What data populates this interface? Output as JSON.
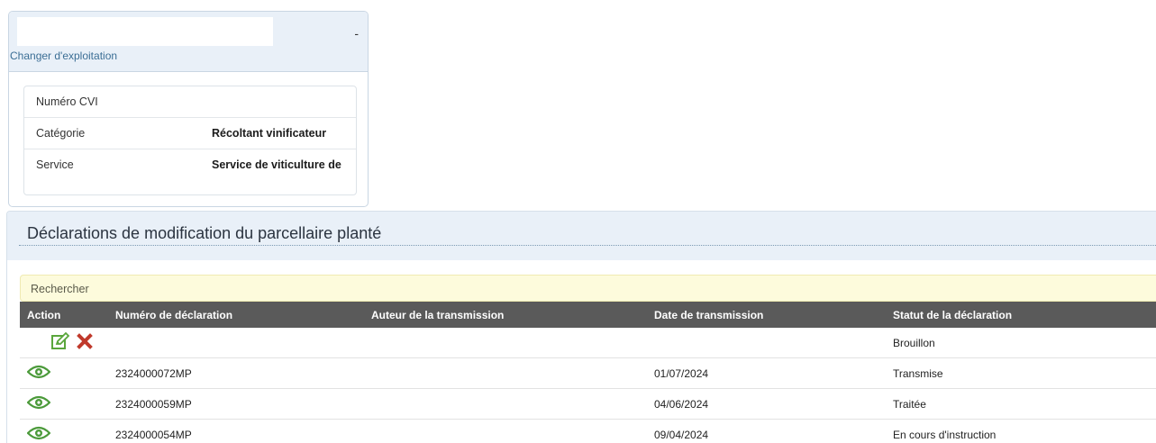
{
  "exploitation": {
    "dash": "-",
    "change_link": "Changer d'exploitation",
    "fields": [
      {
        "label": "Numéro CVI",
        "value": ""
      },
      {
        "label": "Catégorie",
        "value": "Récoltant vinificateur"
      },
      {
        "label": "Service",
        "value": "Service de viticulture de"
      }
    ]
  },
  "panel": {
    "title": "Déclarations de modification du parcellaire planté",
    "search_label": "Rechercher"
  },
  "table": {
    "headers": {
      "action": "Action",
      "numero": "Numéro de déclaration",
      "auteur": "Auteur de la transmission",
      "date": "Date de transmission",
      "statut": "Statut de la déclaration"
    },
    "rows": [
      {
        "actions": [
          "edit-icon",
          "delete-icon"
        ],
        "numero": "",
        "auteur": "",
        "date": "",
        "statut": "Brouillon"
      },
      {
        "actions": [
          "view-icon"
        ],
        "numero": "2324000072MP",
        "auteur": "",
        "date": "01/07/2024",
        "statut": "Transmise"
      },
      {
        "actions": [
          "view-icon"
        ],
        "numero": "2324000059MP",
        "auteur": "",
        "date": "04/06/2024",
        "statut": "Traitée"
      },
      {
        "actions": [
          "view-icon"
        ],
        "numero": "2324000054MP",
        "auteur": "",
        "date": "09/04/2024",
        "statut": "En cours d'instruction"
      }
    ]
  },
  "colors": {
    "header_bg": "#5a5a5a",
    "panel_bg": "#e9f0f8",
    "search_bg": "#fdfbdc",
    "edit_green": "#5aa63c",
    "view_green": "#4b9a3a",
    "delete_red": "#c0392b",
    "link": "#3b6e95"
  }
}
